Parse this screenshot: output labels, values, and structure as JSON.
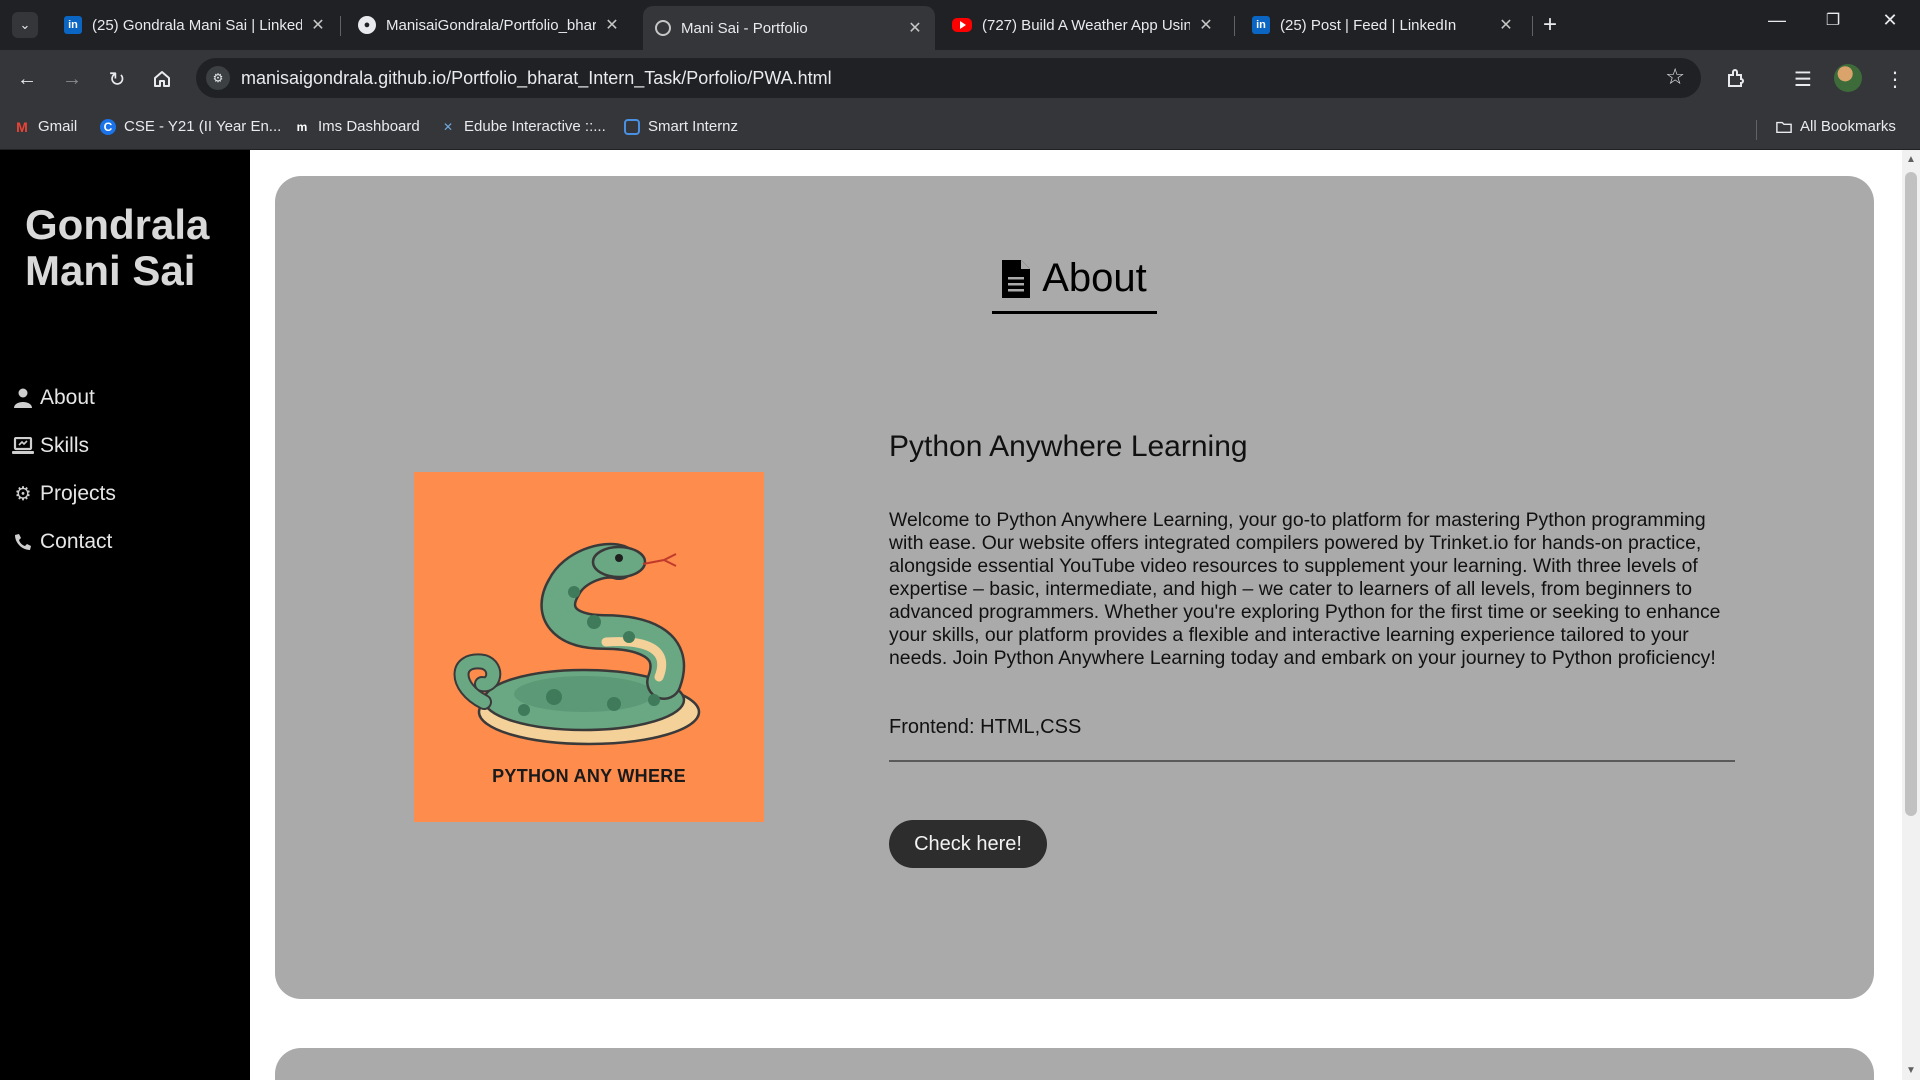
{
  "browser": {
    "tabs": [
      {
        "title": "(25) Gondrala Mani Sai | LinkedIn",
        "favicon": "linkedin-icon",
        "active": false
      },
      {
        "title": "ManisaiGondrala/Portfolio_bharat_Intern_Task",
        "favicon": "github-icon",
        "active": false
      },
      {
        "title": "Mani Sai - Portfolio",
        "favicon": "globe-icon",
        "active": true
      },
      {
        "title": "(727) Build A Weather App Using JavaScript",
        "favicon": "youtube-icon",
        "active": false
      },
      {
        "title": "(25) Post | Feed | LinkedIn",
        "favicon": "linkedin-icon",
        "active": false
      }
    ],
    "url": "manisaigondrala.github.io/Portfolio_bharat_Intern_Task/Porfolio/PWA.html",
    "bookmarks": [
      {
        "label": "Gmail",
        "icon": "gmail-icon"
      },
      {
        "label": "CSE - Y21 (II Year En...",
        "icon": "c-logo-icon"
      },
      {
        "label": "Ims Dashboard",
        "icon": "ims-icon"
      },
      {
        "label": "Edube Interactive ::...",
        "icon": "edube-icon"
      },
      {
        "label": "Smart Internz",
        "icon": "smart-internz-icon"
      }
    ],
    "all_bookmarks_label": "All Bookmarks"
  },
  "sidebar": {
    "brand": "Gondrala Mani Sai",
    "items": [
      {
        "label": "About",
        "icon": "user-icon"
      },
      {
        "label": "Skills",
        "icon": "laptop-icon"
      },
      {
        "label": "Projects",
        "icon": "gear-icon"
      },
      {
        "label": "Contact",
        "icon": "phone-icon"
      }
    ]
  },
  "section": {
    "title": "About",
    "icon": "document-icon"
  },
  "project": {
    "title": "Python Anywhere Learning",
    "image_caption": "PYTHON ANY WHERE",
    "description": "Welcome to Python Anywhere Learning, your go-to platform for mastering Python programming with ease. Our website offers integrated compilers powered by Trinket.io for hands-on practice, alongside essential YouTube video resources to supplement your learning. With three levels of expertise – basic, intermediate, and high – we cater to learners of all levels, from beginners to advanced programmers. Whether you're exploring Python for the first time or seeking to enhance your skills, our platform provides a flexible and interactive learning experience tailored to your needs. Join Python Anywhere Learning today and embark on your journey to Python proficiency!",
    "tech": "Frontend: HTML,CSS",
    "cta": "Check here!"
  },
  "colors": {
    "sidebar_bg": "#000000",
    "card_bg": "#aaaaaa",
    "image_bg": "#fd8c4d",
    "button_bg": "#2d2d2d"
  }
}
